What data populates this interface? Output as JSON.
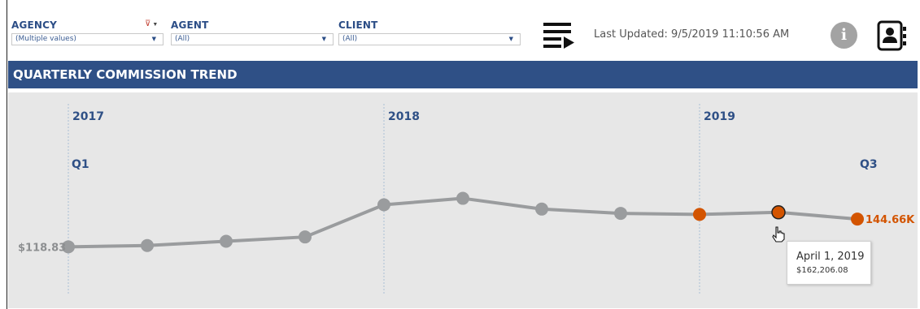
{
  "filters": {
    "agency": {
      "label": "AGENCY",
      "value": "(Multiple values)"
    },
    "agent": {
      "label": "AGENT",
      "value": "(All)"
    },
    "client": {
      "label": "CLIENT",
      "value": "(All)"
    }
  },
  "header": {
    "last_updated": "Last Updated: 9/5/2019 11:10:56 AM",
    "info_label": "i"
  },
  "title": "QUARTERLY COMMISSION TREND",
  "chart_data": {
    "type": "line",
    "title": "QUARTERLY COMMISSION TREND",
    "year_labels": [
      "2017",
      "2018",
      "2019"
    ],
    "quarter_labels": {
      "first": "Q1",
      "last": "Q3"
    },
    "start_label": "$118.83",
    "end_label": "144.66K",
    "series_color": "#9a9c9e",
    "highlight_color": "#d35400",
    "x": [
      "2017 Q1",
      "2017 Q2",
      "2017 Q3",
      "2017 Q4",
      "2018 Q1",
      "2018 Q2",
      "2018 Q3",
      "2018 Q4",
      "2019 Q1",
      "2019 Q2",
      "2019 Q3"
    ],
    "values": [
      118.83,
      120,
      124,
      128,
      158,
      164,
      154,
      150,
      149,
      151,
      144.66
    ],
    "highlighted_points": [
      8,
      9,
      10
    ],
    "hover_point": 9
  },
  "tooltip": {
    "date": "April 1, 2019",
    "value": "$162,206.08"
  }
}
